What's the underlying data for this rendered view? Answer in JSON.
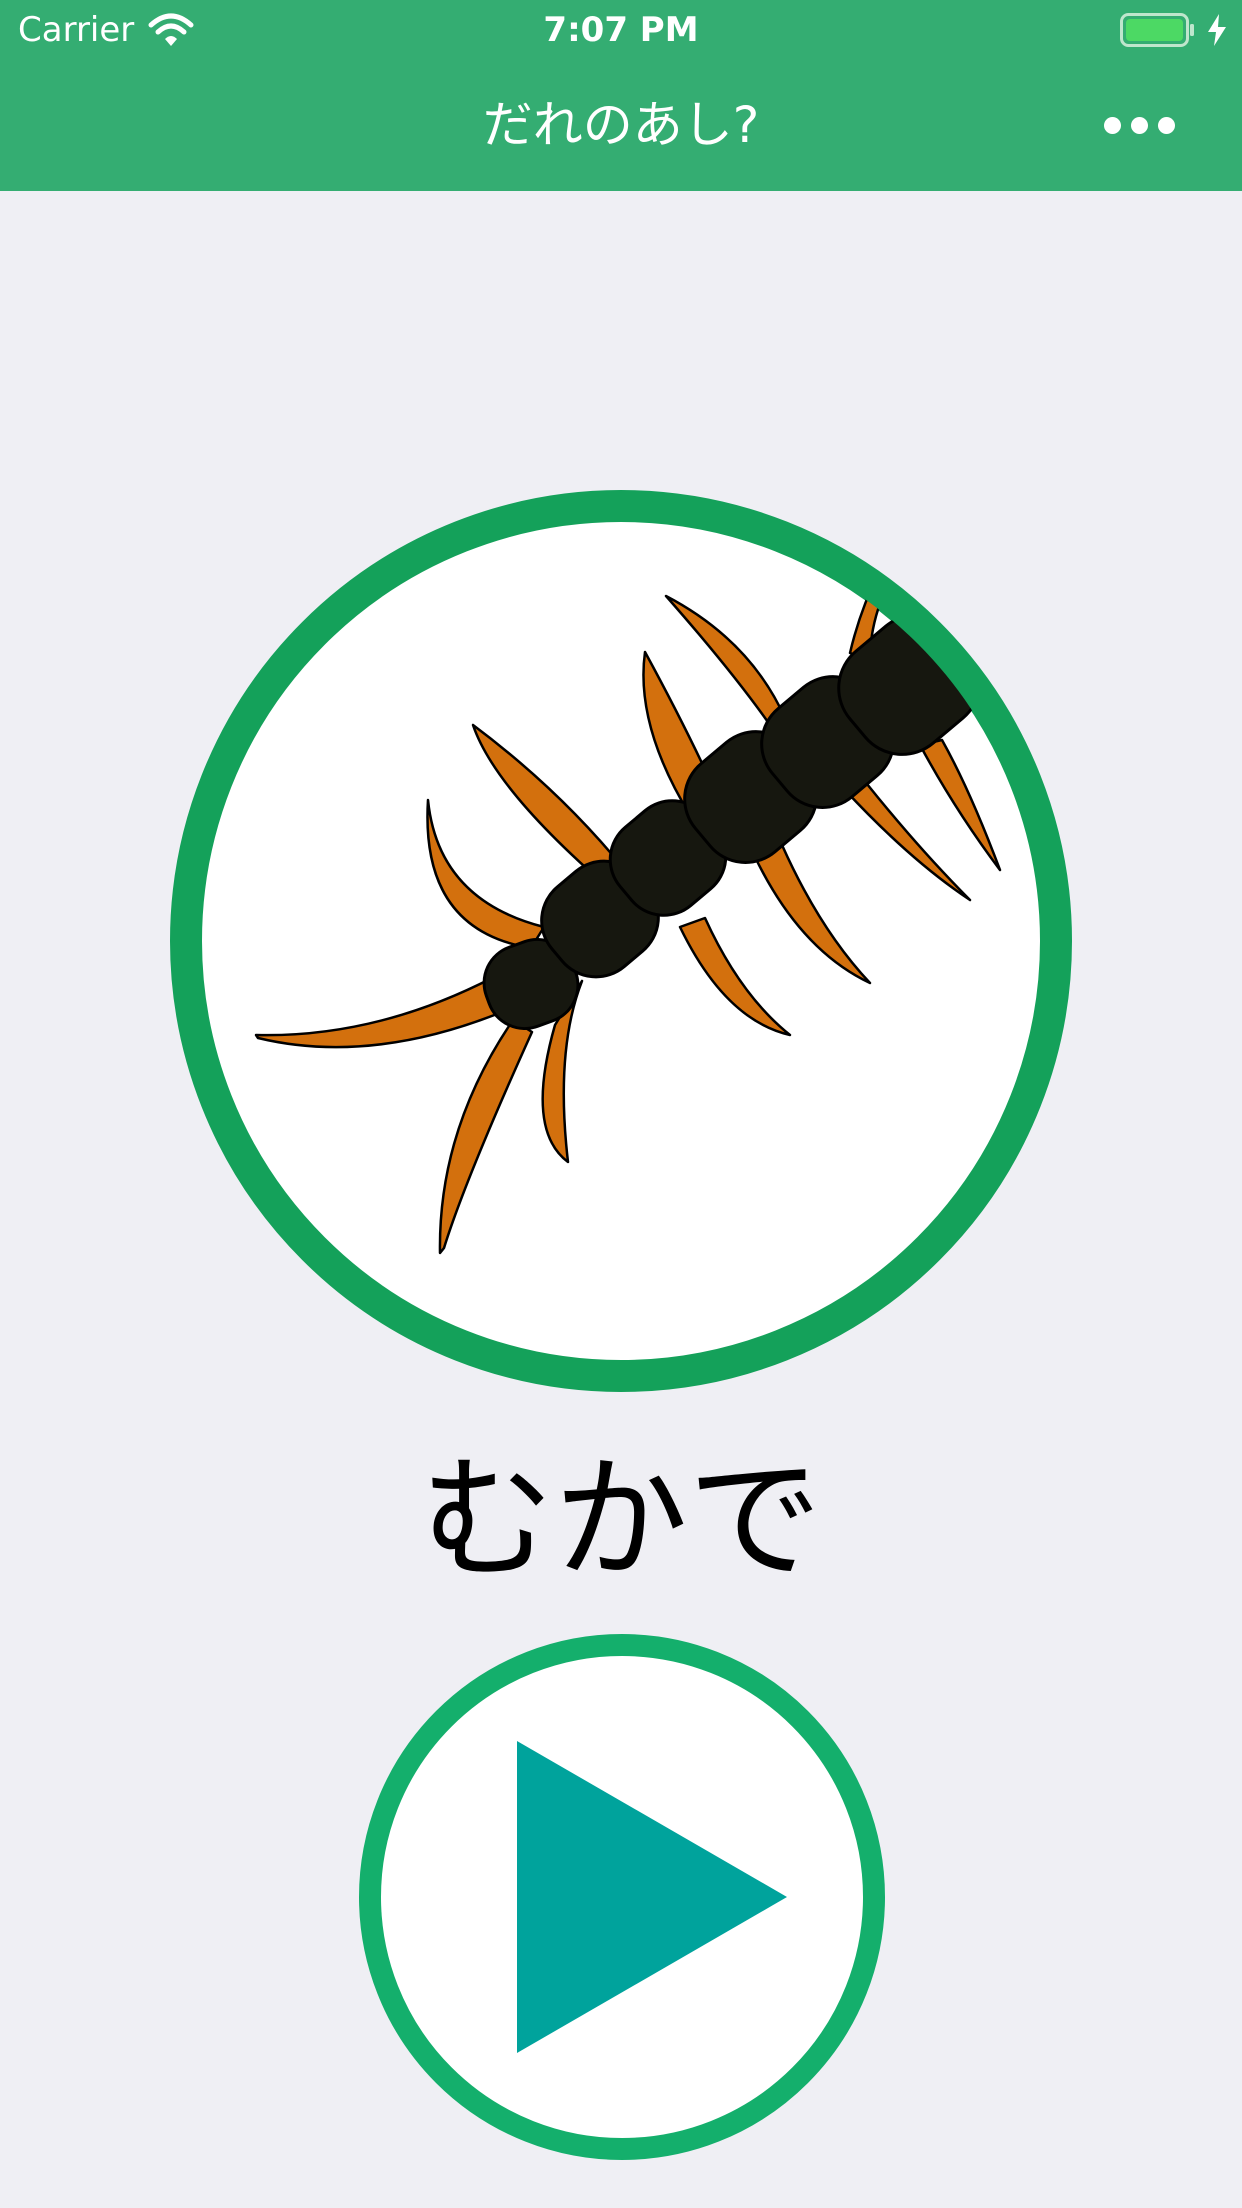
{
  "status_bar": {
    "carrier": "Carrier",
    "time": "7:07 PM",
    "icons": [
      "wifi-icon",
      "battery-icon",
      "charging-bolt-icon"
    ]
  },
  "nav": {
    "title": "だれのあし?",
    "more_icon": "more-horizontal-icon"
  },
  "main": {
    "illustration": "centipede",
    "answer_label": "むかで",
    "play_icon": "play-icon"
  },
  "colors": {
    "header": "#34ad72",
    "background": "#efeff4",
    "circle_border": "#14a15a",
    "play_border": "#14af6c",
    "play_triangle": "#00a39c",
    "centipede_body": "#16170f",
    "centipede_legs": "#d3700d"
  }
}
